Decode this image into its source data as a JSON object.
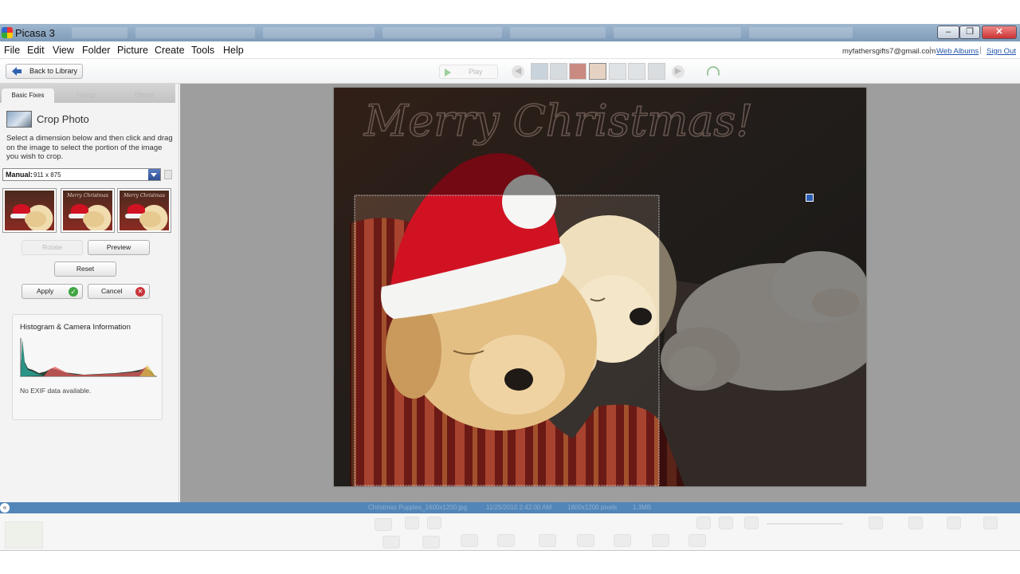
{
  "window": {
    "title": "Picasa 3",
    "controls": {
      "minimize": "‒",
      "maximize": "❐",
      "close": "✕"
    }
  },
  "menu": [
    "File",
    "Edit",
    "View",
    "Folder",
    "Picture",
    "Create",
    "Tools",
    "Help"
  ],
  "account": {
    "email": "myfathersgifts7@gmail.com",
    "web_albums": "Web Albums",
    "sign_out": "Sign Out",
    "separator": "|"
  },
  "toolbar": {
    "back_label": "Back to Library",
    "play_label": "Play"
  },
  "edit_panel": {
    "tabs": [
      {
        "label": "Basic Fixes",
        "active": true
      },
      {
        "label": "Tuning",
        "active": false
      },
      {
        "label": "Effects",
        "active": false
      }
    ],
    "crop": {
      "title": "Crop Photo",
      "instructions": "Select a dimension below and then click and drag on the image to select the portion of the image you wish to crop.",
      "dimension_mode": "Manual:",
      "dimension_value": "911 x 875",
      "thumbnail_caption": "Merry Christmas"
    },
    "buttons": {
      "rotate": "Rotate",
      "preview": "Preview",
      "reset": "Reset",
      "apply": "Apply",
      "cancel": "Cancel"
    },
    "histogram": {
      "title": "Histogram & Camera Information",
      "exif_text": "No EXIF data available."
    }
  },
  "photo": {
    "caption": "Merry Christmas!",
    "crop_selection": "911 x 875"
  },
  "status": {
    "filename": "Christmas Puppies_1600x1200.jpg",
    "datetime": "11/25/2010 2:42:00 AM",
    "dimensions": "1600x1200 pixels",
    "filesize": "1.3MB"
  },
  "colors": {
    "status_bar": "#5286b8",
    "title_bar": "#8aa4c0",
    "hat_red": "#d01223",
    "apply_green": "#3fa544",
    "cancel_red": "#c8343a"
  }
}
